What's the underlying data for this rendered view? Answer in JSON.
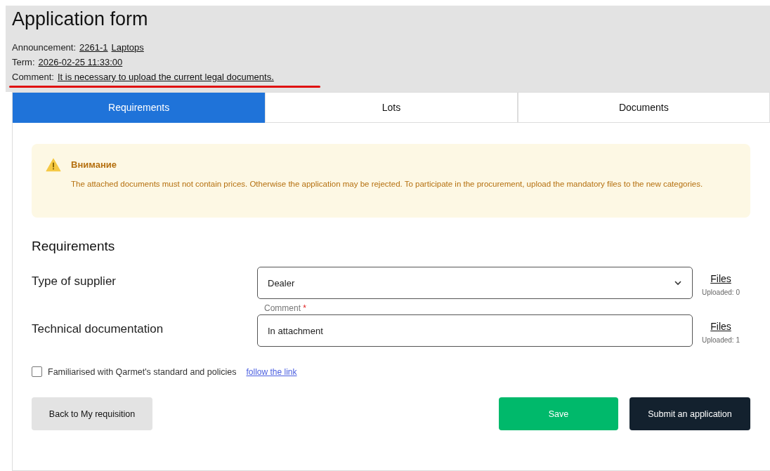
{
  "header": {
    "title": "Application form",
    "announcement": {
      "label": "Announcement:",
      "number": "2261-1",
      "subject": "Laptops"
    },
    "term": {
      "label": "Term:",
      "value": "2026-02-25 11:33:00"
    },
    "comment": {
      "label": "Comment:",
      "value": "It is necessary to upload the current legal documents.",
      "highlighted": true
    }
  },
  "tabs": [
    {
      "label": "Requirements",
      "selected": true
    },
    {
      "label": "Lots",
      "selected": false
    },
    {
      "label": "Documents",
      "selected": false
    }
  ],
  "alert": {
    "title": "Внимание",
    "text": "The attached documents must not contain prices. Otherwise the application may be rejected. To participate in the procurement, upload the mandatory files to the new categories."
  },
  "section_title": "Requirements",
  "requirements": [
    {
      "kind": "select",
      "label": "Type of supplier",
      "value": "Dealer",
      "files_link": "Files",
      "uploaded": "Uploaded: 0"
    },
    {
      "kind": "text",
      "label": "Technical documentation",
      "field_label": "Comment",
      "required_mark": "*",
      "value": "In attachment",
      "files_link": "Files",
      "uploaded": "Uploaded: 1"
    }
  ],
  "agreement": {
    "checked": false,
    "label": "Familiarised with Qarmet's standard and policies",
    "link": "follow the link"
  },
  "buttons": {
    "back": "Back to My requisition",
    "save": "Save",
    "submit": "Submit an application"
  }
}
